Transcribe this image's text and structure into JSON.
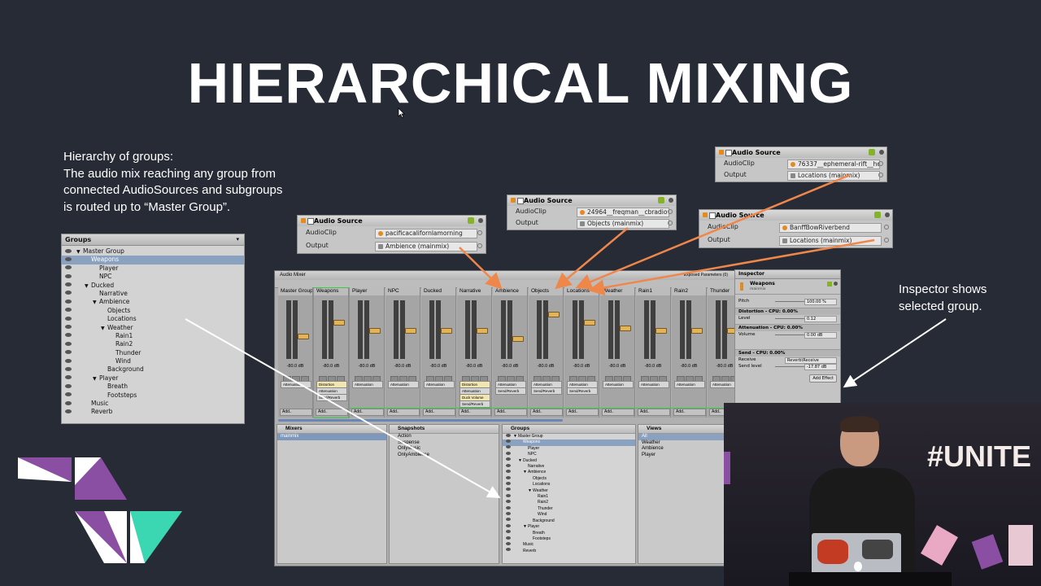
{
  "slide": {
    "title": "HIERARCHICAL MIXING",
    "caption_left": [
      "Hierarchy of groups:",
      "The audio mix reaching any group from",
      "connected AudioSources and subgroups",
      "is routed up to “Master Group”."
    ],
    "caption_right": [
      "Inspector shows",
      "selected group."
    ],
    "hashtag": "#UNITE"
  },
  "groups_panel": {
    "title": "Groups",
    "items": [
      {
        "label": "Master Group",
        "indent": 0,
        "arrow": "▼",
        "selected": false
      },
      {
        "label": "Weapons",
        "indent": 1,
        "arrow": "",
        "selected": true
      },
      {
        "label": "Player",
        "indent": 2,
        "arrow": "",
        "selected": false
      },
      {
        "label": "NPC",
        "indent": 2,
        "arrow": "",
        "selected": false
      },
      {
        "label": "Ducked",
        "indent": 1,
        "arrow": "▼",
        "selected": false
      },
      {
        "label": "Narrative",
        "indent": 2,
        "arrow": "",
        "selected": false
      },
      {
        "label": "Ambience",
        "indent": 2,
        "arrow": "▼",
        "selected": false
      },
      {
        "label": "Objects",
        "indent": 3,
        "arrow": "",
        "selected": false
      },
      {
        "label": "Locations",
        "indent": 3,
        "arrow": "",
        "selected": false
      },
      {
        "label": "Weather",
        "indent": 3,
        "arrow": "▼",
        "selected": false
      },
      {
        "label": "Rain1",
        "indent": 4,
        "arrow": "",
        "selected": false
      },
      {
        "label": "Rain2",
        "indent": 4,
        "arrow": "",
        "selected": false
      },
      {
        "label": "Thunder",
        "indent": 4,
        "arrow": "",
        "selected": false
      },
      {
        "label": "Wind",
        "indent": 4,
        "arrow": "",
        "selected": false
      },
      {
        "label": "Background",
        "indent": 3,
        "arrow": "",
        "selected": false
      },
      {
        "label": "Player",
        "indent": 2,
        "arrow": "▼",
        "selected": false
      },
      {
        "label": "Breath",
        "indent": 3,
        "arrow": "",
        "selected": false
      },
      {
        "label": "Footsteps",
        "indent": 3,
        "arrow": "",
        "selected": false
      },
      {
        "label": "Music",
        "indent": 1,
        "arrow": "",
        "selected": false
      },
      {
        "label": "Reverb",
        "indent": 1,
        "arrow": "",
        "selected": false
      }
    ]
  },
  "audio_sources": [
    {
      "title": "Audio Source",
      "clip_label": "AudioClip",
      "clip": "pacificacalifornlamorning",
      "output_label": "Output",
      "output": "Ambience (mainmix)"
    },
    {
      "title": "Audio Source",
      "clip_label": "AudioClip",
      "clip": "24964__freqman__cbradio",
      "output_label": "Output",
      "output": "Objects (mainmix)"
    },
    {
      "title": "Audio Source",
      "clip_label": "AudioClip",
      "clip": "76337__ephemeral-rift__hc",
      "output_label": "Output",
      "output": "Locations (mainmix)"
    },
    {
      "title": "Audio Source",
      "clip_label": "AudioClip",
      "clip": "BanffBowRiverbend",
      "output_label": "Output",
      "output": "Locations (mainmix)"
    }
  ],
  "mixer": {
    "tab": "Audio Mixer",
    "exposed_label": "Exposed Parameters (0)",
    "strips": [
      {
        "name": "Master Group",
        "db": "-80.0 dB",
        "effects": [
          "Attenuation"
        ],
        "level": 0.4
      },
      {
        "name": "Weapons",
        "db": "-80.0 dB",
        "effects": [
          "Distortion",
          "Attenuation",
          "Send/Reverb"
        ],
        "level": 0.65
      },
      {
        "name": "Player",
        "db": "-80.0 dB",
        "effects": [
          "Attenuation"
        ],
        "level": 0.5
      },
      {
        "name": "NPC",
        "db": "-80.0 dB",
        "effects": [
          "Attenuation"
        ],
        "level": 0.5
      },
      {
        "name": "Ducked",
        "db": "-80.0 dB",
        "effects": [
          "Attenuation"
        ],
        "level": 0.5
      },
      {
        "name": "Narrative",
        "db": "-80.0 dB",
        "effects": [
          "Distortion",
          "Attenuation",
          "Duck Volume",
          "Send/Reverb"
        ],
        "level": 0.5
      },
      {
        "name": "Ambience",
        "db": "-80.0 dB",
        "effects": [
          "Attenuation",
          "Send/Reverb"
        ],
        "level": 0.35
      },
      {
        "name": "Objects",
        "db": "-80.0 dB",
        "effects": [
          "Attenuation",
          "Send/Reverb"
        ],
        "level": 0.8
      },
      {
        "name": "Locations",
        "db": "-80.0 dB",
        "effects": [
          "Attenuation",
          "Send/Reverb"
        ],
        "level": 0.65
      },
      {
        "name": "Weather",
        "db": "-80.0 dB",
        "effects": [
          "Attenuation"
        ],
        "level": 0.55
      },
      {
        "name": "Rain1",
        "db": "-80.0 dB",
        "effects": [
          "Attenuation"
        ],
        "level": 0.5
      },
      {
        "name": "Rain2",
        "db": "-80.0 dB",
        "effects": [
          "Attenuation"
        ],
        "level": 0.5
      },
      {
        "name": "Thunder",
        "db": "-80.0 dB",
        "effects": [
          "Attenuation"
        ],
        "level": 0.5
      }
    ],
    "add_label": "Add..",
    "mixers_title": "Mixers",
    "mixers_items": [
      "mainmix"
    ],
    "snapshots_title": "Snapshots",
    "snapshots_items": [
      "Action",
      "Suspense",
      "OnlyMusic",
      "OnlyAmbience"
    ],
    "groups_title": "Groups",
    "views_title": "Views",
    "views_items": [
      "All",
      "Weather",
      "Ambience",
      "Player"
    ]
  },
  "inspector": {
    "title": "Inspector",
    "group_name": "Weapons",
    "subtitle": "mainmix",
    "pitch_label": "Pitch",
    "pitch_value": "100.00 %",
    "distortion_title": "Distortion - CPU: 0.00%",
    "level_label": "Level",
    "level_value": "0.12",
    "attenuation_title": "Attenuation - CPU: 0.00%",
    "volume_label": "Volume",
    "volume_value": "0.00 dB",
    "send_title": "Send - CPU: 0.00%",
    "receive_label": "Receive",
    "receive_value": "Reverb\\Receive",
    "sendlevel_label": "Send level",
    "sendlevel_value": "-17.87 dB",
    "add_effect": "Add Effect"
  },
  "colors": {
    "background": "#262b35",
    "accent_purple": "#8a4fa3",
    "accent_teal": "#3bd6b2",
    "arrow_orange": "#f0874a",
    "selection_green": "#41c84a"
  }
}
